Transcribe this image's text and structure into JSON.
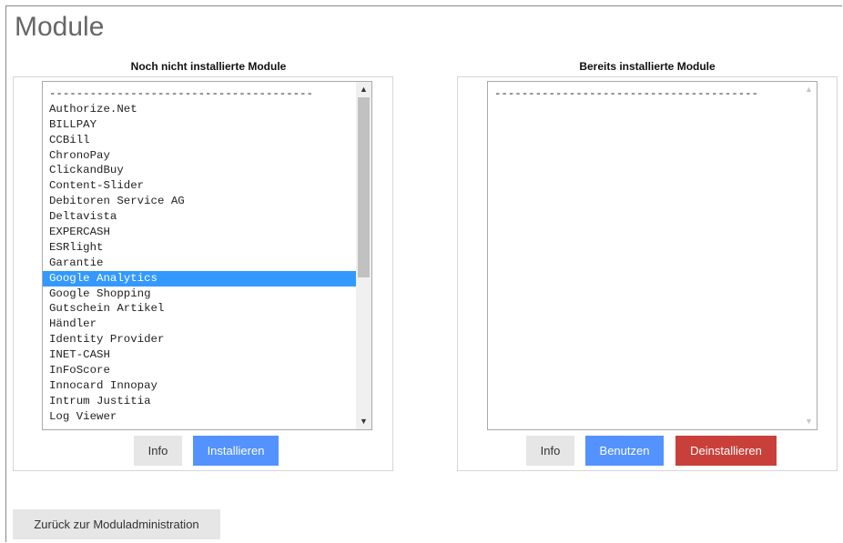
{
  "page": {
    "title": "Module"
  },
  "left": {
    "heading": "Noch nicht installierte Module",
    "items": [
      "---------------------------------------",
      "Authorize.Net",
      "BILLPAY",
      "CCBill",
      "ChronoPay",
      "ClickandBuy",
      "Content-Slider",
      "Debitoren Service AG",
      "Deltavista",
      "EXPERCASH",
      "ESRlight",
      "Garantie",
      "Google Analytics",
      "Google Shopping",
      "Gutschein Artikel",
      "Händler",
      "Identity Provider",
      "INET-CASH",
      "InFoScore",
      "Innocard Innopay",
      "Intrum Justitia",
      "Log Viewer"
    ],
    "selected_index": 12,
    "info_label": "Info",
    "install_label": "Installieren"
  },
  "right": {
    "heading": "Bereits installierte Module",
    "items": [
      "---------------------------------------"
    ],
    "info_label": "Info",
    "use_label": "Benutzen",
    "uninstall_label": "Deinstallieren"
  },
  "footer": {
    "back_label": "Zurück zur Moduladministration"
  },
  "colors": {
    "accent": "#5392ff",
    "danger": "#c9403a",
    "selection": "#3399ff"
  }
}
